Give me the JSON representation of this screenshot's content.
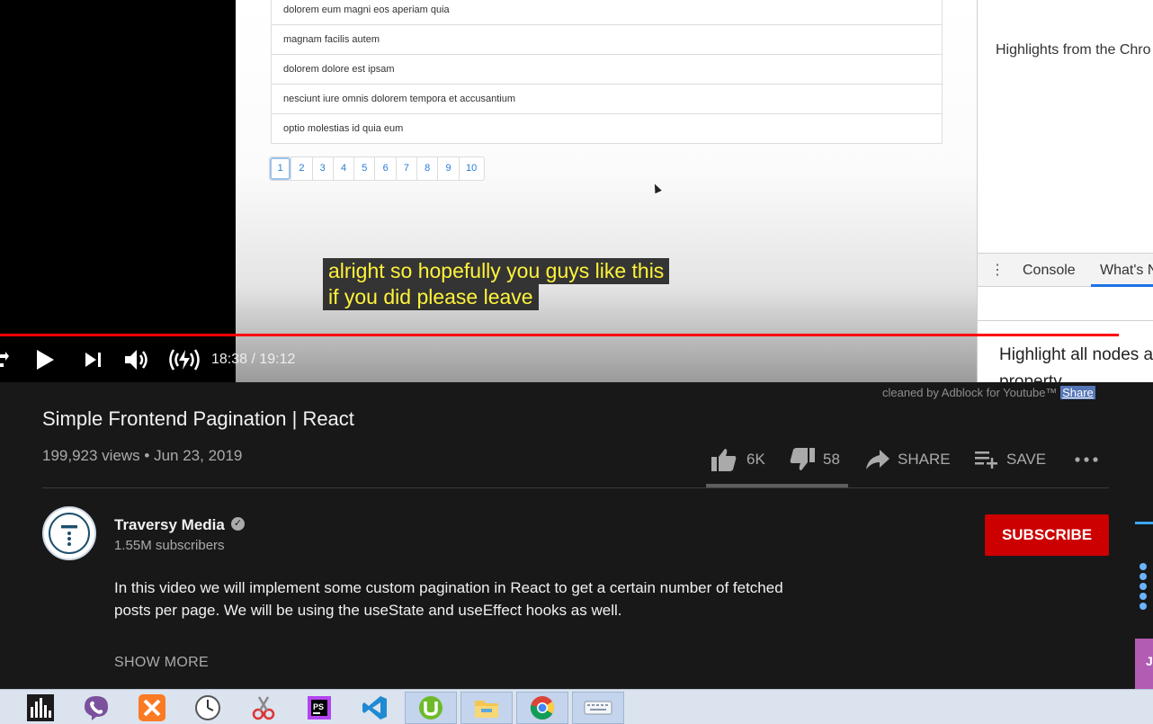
{
  "video_frame": {
    "posts": [
      "dolorem eum magni eos aperiam quia",
      "magnam facilis autem",
      "dolorem dolore est ipsam",
      "nesciunt iure omnis dolorem tempora et accusantium",
      "optio molestias id quia eum"
    ],
    "pages": [
      "1",
      "2",
      "3",
      "4",
      "5",
      "6",
      "7",
      "8",
      "9",
      "10"
    ],
    "active_page": "1",
    "devtools": {
      "tab_console": "Console",
      "tab_whats_new": "What's N",
      "highlights": "Highlights from the Chro",
      "body_line1": "Highlight all nodes a",
      "body_line2": "property"
    }
  },
  "captions": {
    "line1": "alright so hopefully you guys like this",
    "line2": "if you did please leave"
  },
  "player": {
    "time": "18:38 / 19:12",
    "progress": 0.9705,
    "progress_color": "#ff0000"
  },
  "adblock": {
    "text": "cleaned by Adblock for Youtube™",
    "share": "Share"
  },
  "video": {
    "title": "Simple Frontend Pagination | React",
    "views_date": "199,923 views • Jun 23, 2019",
    "likes": "6K",
    "dislikes": "58",
    "share_label": "SHARE",
    "save_label": "SAVE"
  },
  "channel": {
    "name": "Traversy Media",
    "subscribers": "1.55M subscribers",
    "subscribe_label": "SUBSCRIBE",
    "subscribe_color": "#cc0000"
  },
  "description": {
    "text": "In this video we will implement some custom pagination in React to get a certain number of fetched posts per page. We will be using the useState and useEffect hooks as well.",
    "show_more": "SHOW MORE"
  },
  "sidebar_peek": {
    "thumb_letter": "J"
  },
  "taskbar": {
    "apps": [
      "equalizer-icon",
      "viber-icon",
      "xampp-icon",
      "clock-icon",
      "snipping-tool-icon",
      "phpstorm-icon",
      "vscode-icon",
      "utorrent-icon",
      "file-explorer-icon",
      "chrome-icon",
      "keyboard-icon"
    ]
  }
}
